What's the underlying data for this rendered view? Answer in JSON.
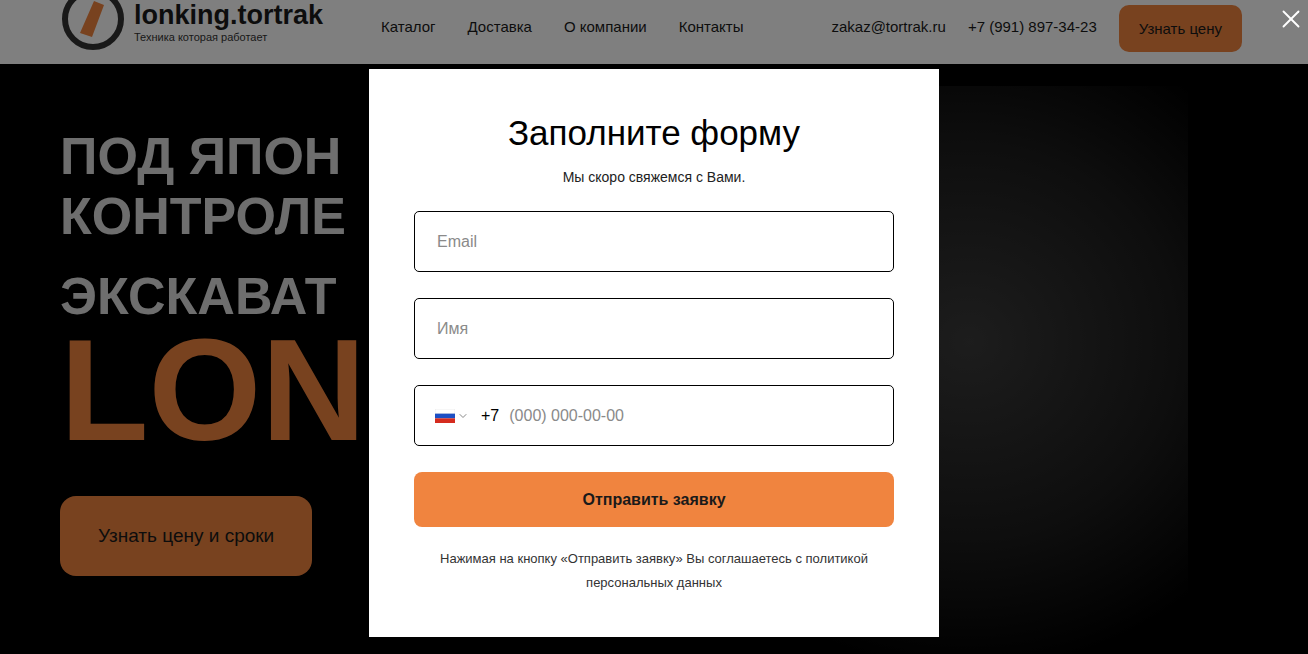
{
  "header": {
    "logo": {
      "name": "lonking.tortrak",
      "tagline": "Техника которая работает"
    },
    "nav": [
      "Каталог",
      "Доставка",
      "О компании",
      "Контакты"
    ],
    "email": "zakaz@tortrak.ru",
    "phone": "+7 (991) 897-34-23",
    "cta": "Узнать цену"
  },
  "hero": {
    "lines": [
      "ПОД ЯПОН",
      "КОНТРОЛЕ"
    ],
    "subtitle": "ЭКСКАВАТ",
    "brand": "LON",
    "button": "Узнать цену и сроки"
  },
  "modal": {
    "title": "Заполните форму",
    "subtitle": "Мы скоро свяжемся с Вами.",
    "fields": [
      {
        "kind": "text",
        "placeholder": "Email"
      },
      {
        "kind": "text",
        "placeholder": "Имя"
      },
      {
        "kind": "phone",
        "prefix": "+7",
        "placeholder": "(000) 000-00-00"
      }
    ],
    "submit": "Отправить заявку",
    "consent": "Нажимая на кнопку «Отправить заявку» Вы соглашаетесь с политикой персональных данных"
  }
}
